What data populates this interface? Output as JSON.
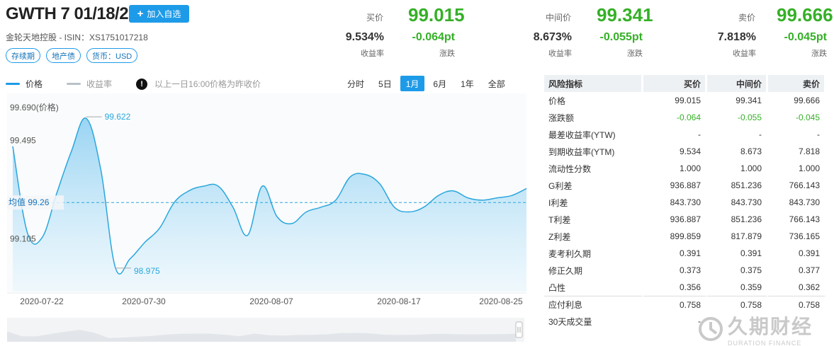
{
  "header": {
    "title": "GWTH 7 01/18/21",
    "add_button": "加入自选",
    "subtitle": "金轮天地控股 - ISIN：XS1751017218",
    "tags": [
      "存续期",
      "地产债",
      "货币：USD"
    ]
  },
  "quotes": {
    "bid": {
      "label": "买价",
      "price": "99.015",
      "yield": "9.534%",
      "yield_label": "收益率",
      "change": "-0.064pt",
      "change_label": "涨跌"
    },
    "mid": {
      "label": "中间价",
      "price": "99.341",
      "yield": "8.673%",
      "yield_label": "收益率",
      "change": "-0.055pt",
      "change_label": "涨跌"
    },
    "ask": {
      "label": "卖价",
      "price": "99.666",
      "yield": "7.818%",
      "yield_label": "收益率",
      "change": "-0.045pt",
      "change_label": "涨跌"
    }
  },
  "chart_toolbar": {
    "legend_price": "价格",
    "legend_yield": "收益率",
    "note": "以上一日16:00价格为昨收价",
    "ranges": [
      "分时",
      "5日",
      "1月",
      "6月",
      "1年",
      "全部"
    ],
    "active_range": "1月"
  },
  "colors": {
    "accent": "#1e9be8",
    "up_green": "#35b027",
    "price_line": "#2aa7dd",
    "yield_line": "#b9c0c8"
  },
  "chart_data": {
    "type": "area",
    "series": [
      {
        "name": "价格",
        "values": [
          99.5,
          99.13,
          99.11,
          99.3,
          99.48,
          99.62,
          99.4,
          98.98,
          99.02,
          99.09,
          99.15,
          99.26,
          99.31,
          99.33,
          99.33,
          99.24,
          99.12,
          99.33,
          99.2,
          99.17,
          99.22,
          99.24,
          99.27,
          99.37,
          99.38,
          99.34,
          99.24,
          99.22,
          99.24,
          99.29,
          99.31,
          99.28,
          99.27,
          99.28,
          99.29,
          99.32
        ]
      }
    ],
    "x_labels": [
      "2020-07-22",
      "2020-07-30",
      "2020-08-07",
      "2020-08-17",
      "2020-08-25"
    ],
    "y_axis_title": "99.690(价格)",
    "y_ticks": [
      "99.495",
      "99.105"
    ],
    "max_label": "99.622",
    "min_label": "98.975",
    "mean_label": "均值 99.26",
    "mean_value": 99.26,
    "ylim": [
      98.91,
      99.69
    ]
  },
  "risk_table": {
    "headers": [
      "风险指标",
      "买价",
      "中间价",
      "卖价"
    ],
    "rows": [
      {
        "name": "价格",
        "bid": "99.015",
        "mid": "99.341",
        "ask": "99.666",
        "green": false
      },
      {
        "name": "涨跌额",
        "bid": "-0.064",
        "mid": "-0.055",
        "ask": "-0.045",
        "green": true
      },
      {
        "name": "最差收益率(YTW)",
        "bid": "-",
        "mid": "-",
        "ask": "-",
        "green": false
      },
      {
        "name": "到期收益率(YTM)",
        "bid": "9.534",
        "mid": "8.673",
        "ask": "7.818",
        "green": false
      },
      {
        "name": "流动性分数",
        "bid": "1.000",
        "mid": "1.000",
        "ask": "1.000",
        "green": false
      },
      {
        "name": "G利差",
        "bid": "936.887",
        "mid": "851.236",
        "ask": "766.143",
        "green": false
      },
      {
        "name": "I利差",
        "bid": "843.730",
        "mid": "843.730",
        "ask": "843.730",
        "green": false
      },
      {
        "name": "T利差",
        "bid": "936.887",
        "mid": "851.236",
        "ask": "766.143",
        "green": false
      },
      {
        "name": "Z利差",
        "bid": "899.859",
        "mid": "817.879",
        "ask": "736.165",
        "green": false
      },
      {
        "name": "麦考利久期",
        "bid": "0.391",
        "mid": "0.391",
        "ask": "0.391",
        "green": false
      },
      {
        "name": "修正久期",
        "bid": "0.373",
        "mid": "0.375",
        "ask": "0.377",
        "green": false
      },
      {
        "name": "凸性",
        "bid": "0.356",
        "mid": "0.359",
        "ask": "0.362",
        "green": false
      }
    ],
    "extra_rows": [
      {
        "name": "应付利息",
        "bid": "0.758",
        "mid": "0.758",
        "ask": "0.758"
      },
      {
        "name": "30天成交量",
        "bid": "-",
        "mid": "",
        "ask": ""
      }
    ]
  },
  "watermark": {
    "cn": "久期财经",
    "en": "DURATION FINANCE"
  }
}
